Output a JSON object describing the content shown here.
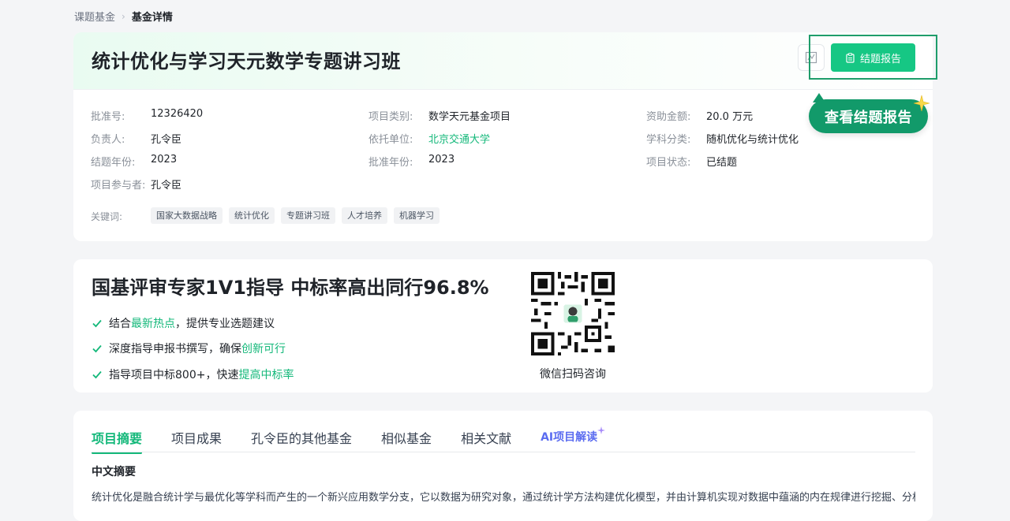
{
  "breadcrumb": {
    "parent": "课题基金",
    "separator": "›",
    "current": "基金详情"
  },
  "project": {
    "title": "统计优化与学习天元数学专题讲习班",
    "report_button_label": "结题报告",
    "bubble_label": "查看结题报告",
    "fields": {
      "approval_no": {
        "label": "批准号:",
        "value": "12326420"
      },
      "category": {
        "label": "项目类别:",
        "value": "数学天元基金项目"
      },
      "funding": {
        "label": "资助金额:",
        "value": "20.0 万元"
      },
      "leader": {
        "label": "负责人:",
        "value": "孔令臣"
      },
      "institution": {
        "label": "依托单位:",
        "value": "北京交通大学"
      },
      "discipline": {
        "label": "学科分类:",
        "value": "随机优化与统计优化"
      },
      "end_year": {
        "label": "结题年份:",
        "value": "2023"
      },
      "approval_year": {
        "label": "批准年份:",
        "value": "2023"
      },
      "status": {
        "label": "项目状态:",
        "value": "已结题"
      },
      "participants": {
        "label": "项目参与者:",
        "value": "孔令臣"
      }
    },
    "keywords_label": "关键词:",
    "keywords": [
      "国家大数据战略",
      "统计优化",
      "专题讲习班",
      "人才培养",
      "机器学习"
    ]
  },
  "promo": {
    "title": "国基评审专家1V1指导 中标率高出同行96.8%",
    "items": [
      {
        "prefix": "结合",
        "highlight": "最新热点",
        "suffix": "，提供专业选题建议"
      },
      {
        "prefix": "深度指导申报书撰写，确保",
        "highlight": "创新可行",
        "suffix": ""
      },
      {
        "prefix": "指导项目中标800+，快速",
        "highlight": "提高中标率",
        "suffix": ""
      }
    ],
    "qr_caption": "微信扫码咨询"
  },
  "tabs": [
    "项目摘要",
    "项目成果",
    "孔令臣的其他基金",
    "相似基金",
    "相关文献",
    "AI项目解读"
  ],
  "abstract": {
    "title": "中文摘要",
    "text": "统计优化是融合统计学与最优化等学科而产生的一个新兴应用数学分支，它以数据为研究对象，通过统计学方法构建优化模型，并由计算机实现对数据中蕴涵的内在规律进行挖掘、分析、预"
  },
  "colors": {
    "accent": "#16c784",
    "accent_dark": "#129a6a",
    "ai": "#5b6cf0"
  }
}
